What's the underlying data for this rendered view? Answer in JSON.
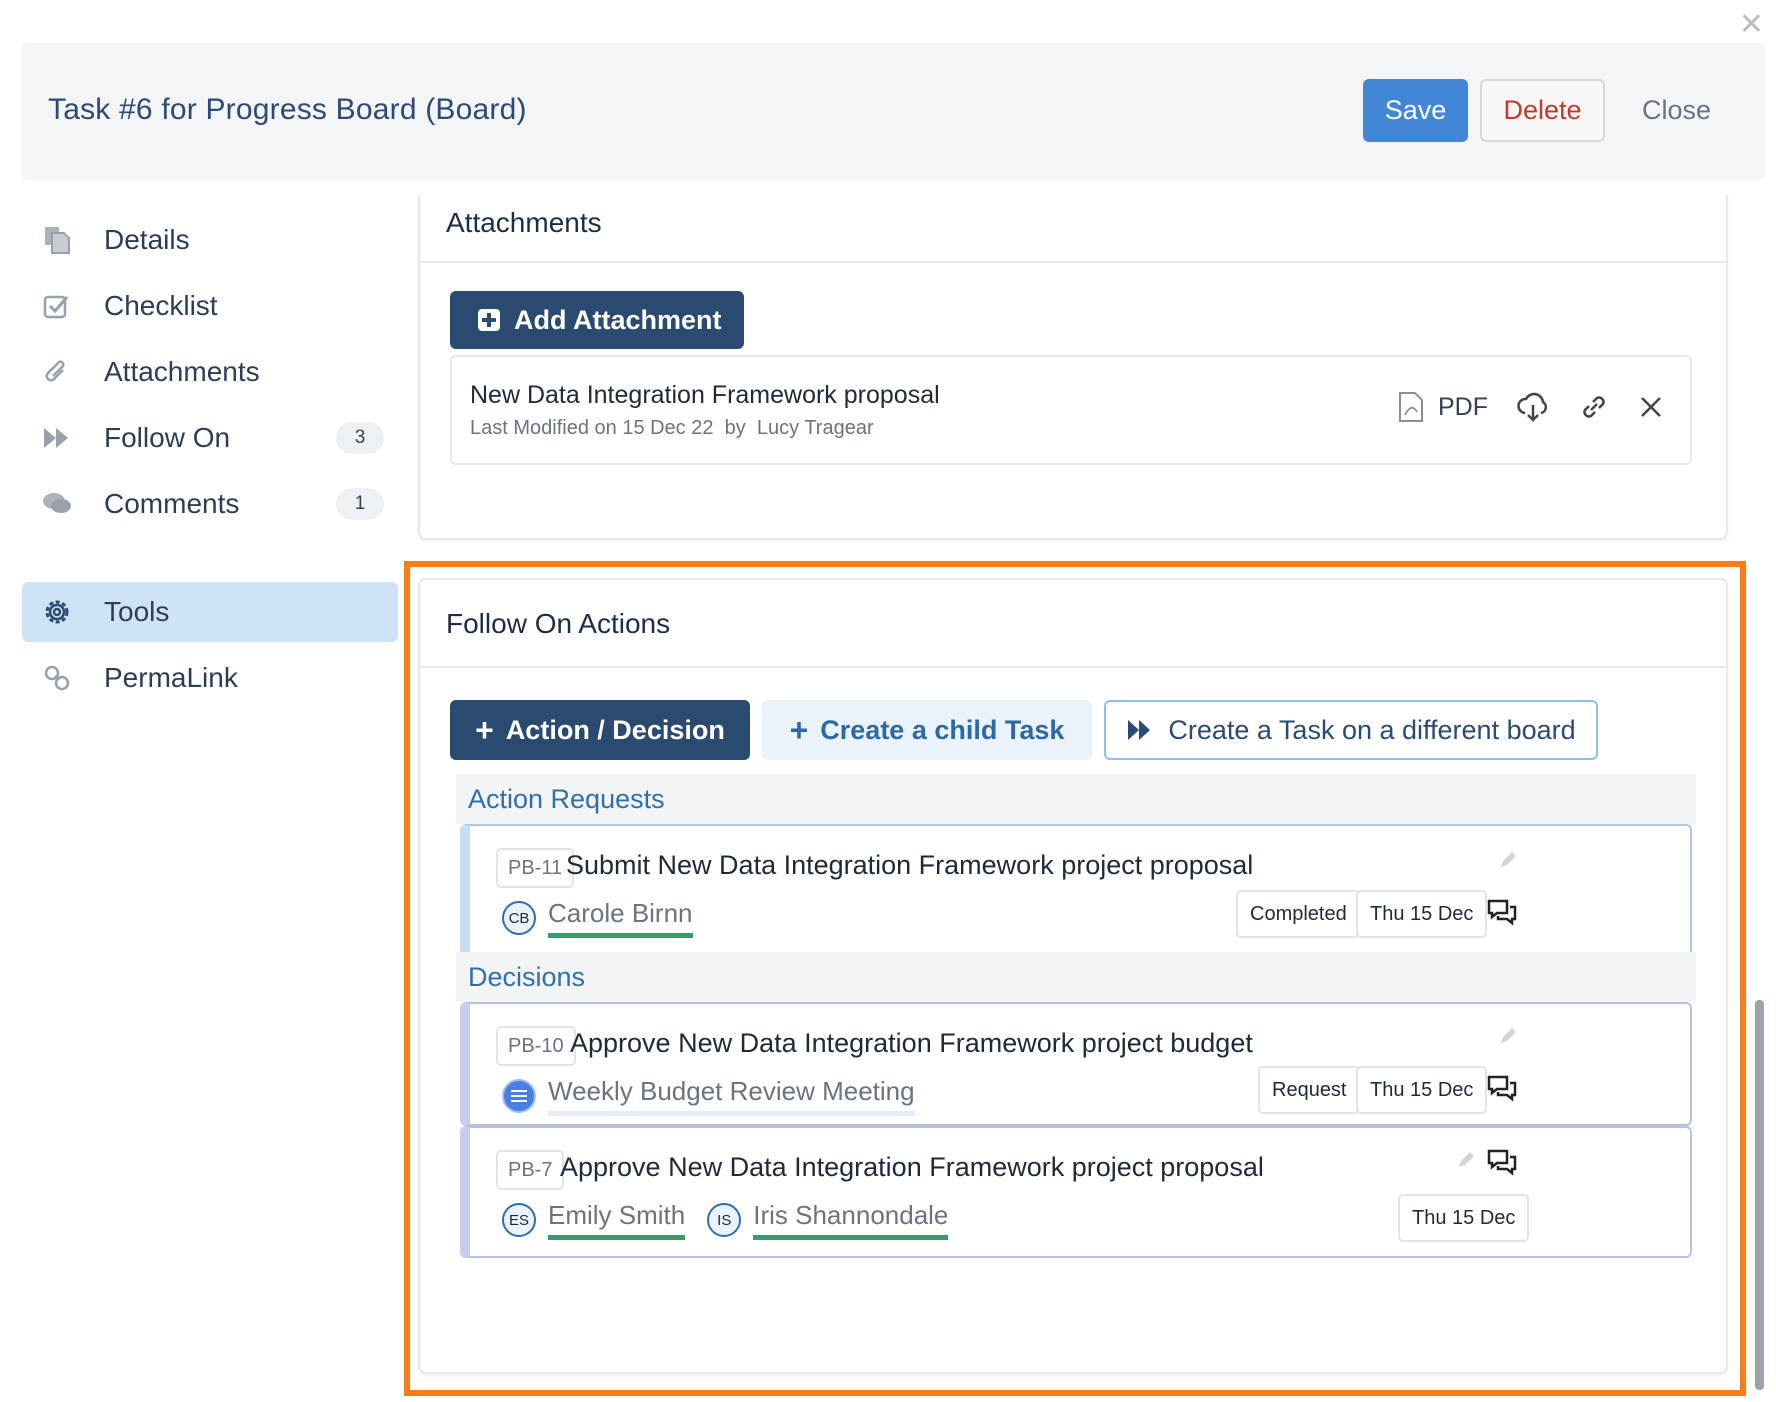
{
  "header": {
    "title": "Task #6 for Progress Board (Board)",
    "save_label": "Save",
    "delete_label": "Delete",
    "close_label": "Close"
  },
  "sidebar": {
    "items": [
      {
        "label": "Details",
        "icon": "documents-icon"
      },
      {
        "label": "Checklist",
        "icon": "checkbox-icon"
      },
      {
        "label": "Attachments",
        "icon": "paperclip-icon"
      },
      {
        "label": "Follow On",
        "icon": "fast-forward-icon",
        "badge": "3"
      },
      {
        "label": "Comments",
        "icon": "comments-icon",
        "badge": "1"
      },
      {
        "label": "Tools",
        "icon": "gear-icon",
        "active": true
      },
      {
        "label": "PermaLink",
        "icon": "link-icon"
      }
    ]
  },
  "attachments": {
    "title": "Attachments",
    "add_label": "Add Attachment",
    "file": {
      "name": "New Data Integration Framework proposal",
      "modified": "Last Modified on 15 Dec 22",
      "by": "by",
      "author": "Lucy Tragear",
      "type": "PDF"
    }
  },
  "follow_on": {
    "title": "Follow On Actions",
    "action_label": "Action / Decision",
    "child_label": "Create a child Task",
    "different_board_label": "Create a Task on a different board",
    "action_requests": {
      "heading": "Action Requests",
      "items": [
        {
          "id": "PB-11",
          "title": "Submit New Data Integration Framework project proposal",
          "avatar": "CB",
          "person": "Carole Birnn",
          "status": "Completed",
          "date": "Thu 15 Dec"
        }
      ]
    },
    "decisions": {
      "heading": "Decisions",
      "items": [
        {
          "id": "PB-10",
          "title": "Approve New Data Integration Framework project budget",
          "person": "Weekly Budget Review Meeting",
          "status": "Request",
          "date": "Thu 15 Dec"
        },
        {
          "id": "PB-7",
          "title": "Approve New Data Integration Framework project proposal",
          "people": [
            {
              "initials": "ES",
              "name": "Emily Smith"
            },
            {
              "initials": "IS",
              "name": "Iris Shannondale"
            }
          ],
          "date": "Thu 15 Dec"
        }
      ]
    }
  },
  "colors": {
    "primary": "#4286d6",
    "navy": "#2b4a70",
    "highlight": "#ff7b15",
    "link_blue": "#2f6fb0",
    "green_underline": "#3a9b66",
    "delete_red": "#c0392b"
  }
}
